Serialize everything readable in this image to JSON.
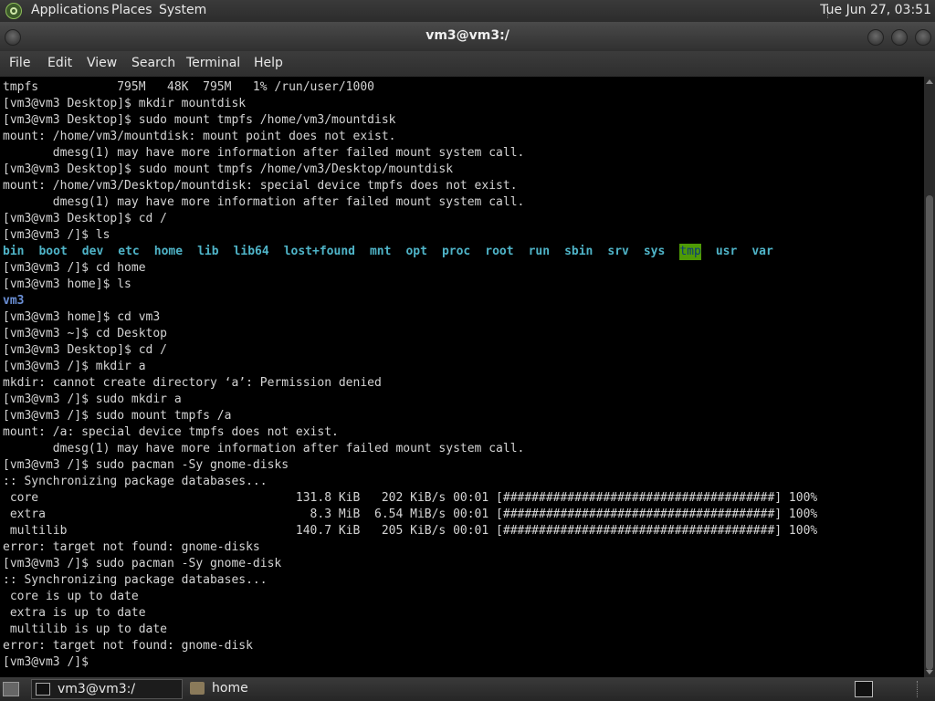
{
  "top_panel": {
    "menus": [
      "Applications",
      "Places",
      "System"
    ],
    "clock": "Tue Jun 27, 03:51"
  },
  "window": {
    "title": "vm3@vm3:/"
  },
  "menubar": {
    "items": [
      "File",
      "Edit",
      "View",
      "Search",
      "Terminal",
      "Help"
    ]
  },
  "terminal": {
    "lines": [
      "tmpfs           795M   48K  795M   1% /run/user/1000",
      "[vm3@vm3 Desktop]$ mkdir mountdisk",
      "[vm3@vm3 Desktop]$ sudo mount tmpfs /home/vm3/mountdisk",
      "mount: /home/vm3/mountdisk: mount point does not exist.",
      "       dmesg(1) may have more information after failed mount system call.",
      "[vm3@vm3 Desktop]$ sudo mount tmpfs /home/vm3/Desktop/mountdisk",
      "mount: /home/vm3/Desktop/mountdisk: special device tmpfs does not exist.",
      "       dmesg(1) may have more information after failed mount system call.",
      "[vm3@vm3 Desktop]$ cd /",
      "[vm3@vm3 /]$ ls",
      "",
      "[vm3@vm3 /]$ cd home",
      "[vm3@vm3 home]$ ls",
      "",
      "[vm3@vm3 home]$ cd vm3",
      "[vm3@vm3 ~]$ cd Desktop",
      "[vm3@vm3 Desktop]$ cd /",
      "[vm3@vm3 /]$ mkdir a",
      "mkdir: cannot create directory ‘a’: Permission denied",
      "[vm3@vm3 /]$ sudo mkdir a",
      "[vm3@vm3 /]$ sudo mount tmpfs /a",
      "mount: /a: special device tmpfs does not exist.",
      "       dmesg(1) may have more information after failed mount system call.",
      "[vm3@vm3 /]$ sudo pacman -Sy gnome-disks",
      ":: Synchronizing package databases...",
      " core                                    131.8 KiB   202 KiB/s 00:01 [######################################] 100%",
      " extra                                     8.3 MiB  6.54 MiB/s 00:01 [######################################] 100%",
      " multilib                                140.7 KiB   205 KiB/s 00:01 [######################################] 100%",
      "error: target not found: gnome-disks",
      "[vm3@vm3 /]$ sudo pacman -Sy gnome-disk",
      ":: Synchronizing package databases...",
      " core is up to date",
      " extra is up to date",
      " multilib is up to date",
      "error: target not found: gnome-disk",
      "[vm3@vm3 /]$ "
    ],
    "ls_root": [
      "bin",
      "boot",
      "dev",
      "etc",
      "home",
      "lib",
      "lib64",
      "lost+found",
      "mnt",
      "opt",
      "proc",
      "root",
      "run",
      "sbin",
      "srv",
      "sys",
      "tmp",
      "usr",
      "var"
    ],
    "ls_home": [
      "vm3"
    ]
  },
  "taskbar": {
    "tasks": [
      "vm3@vm3:/",
      "home"
    ]
  },
  "colors": {
    "terminal_bg": "#000000",
    "terminal_fg": "#d4d4d4",
    "dir_cyan": "#4fb4c8",
    "dir_blue": "#6a8fd6",
    "tmp_highlight": "#4e9a06"
  }
}
